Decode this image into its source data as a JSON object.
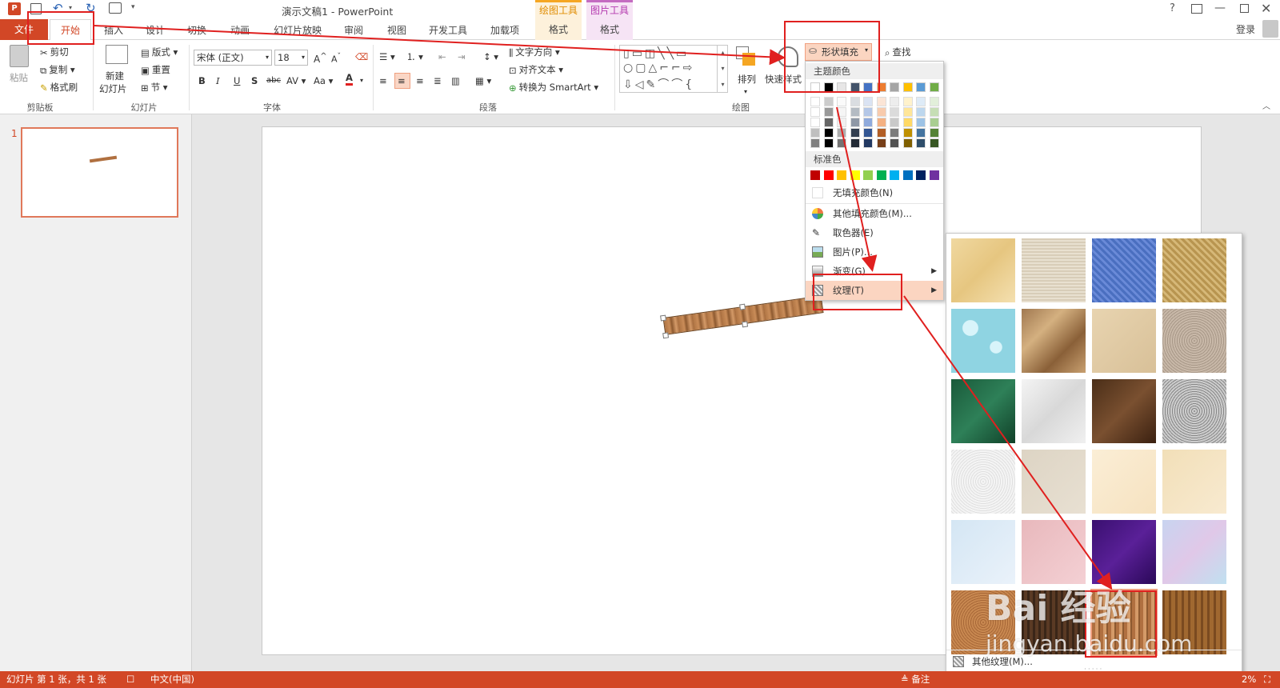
{
  "app": {
    "title": "演示文稿1 - PowerPoint",
    "context_groups": [
      {
        "label": "绘图工具",
        "color": "#f5a623",
        "tab": "格式"
      },
      {
        "label": "图片工具",
        "color": "#c46cc1",
        "tab": "格式"
      }
    ],
    "user": "登录",
    "brand_color": "#d24726"
  },
  "tabs": [
    {
      "label": "文件"
    },
    {
      "label": "开始"
    },
    {
      "label": "插入"
    },
    {
      "label": "设计"
    },
    {
      "label": "切换"
    },
    {
      "label": "动画"
    },
    {
      "label": "幻灯片放映"
    },
    {
      "label": "审阅"
    },
    {
      "label": "视图"
    },
    {
      "label": "开发工具"
    },
    {
      "label": "加载项"
    }
  ],
  "ribbon": {
    "clipboard": {
      "label": "剪贴板",
      "paste": "粘贴",
      "cut": "剪切",
      "copy": "复制",
      "painter": "格式刷"
    },
    "slides": {
      "label": "幻灯片",
      "new_slide_1": "新建",
      "new_slide_2": "幻灯片",
      "layout": "版式",
      "reset": "重置",
      "section": "节"
    },
    "font": {
      "label": "字体",
      "name": "宋体 (正文)",
      "size": "18"
    },
    "paragraph": {
      "label": "段落",
      "text_direction": "文字方向",
      "align_text": "对齐文本",
      "smartart": "转换为 SmartArt"
    },
    "drawing": {
      "label": "绘图",
      "arrange": "排列",
      "quick_styles": "快速样式",
      "shape_fill": "形状填充"
    },
    "editing": {
      "find": "查找"
    }
  },
  "dropdown": {
    "theme_colors_label": "主题颜色",
    "theme_colors": [
      "#ffffff",
      "#000000",
      "#e7e6e6",
      "#44546a",
      "#4472c4",
      "#ed7d31",
      "#a5a5a5",
      "#ffc000",
      "#5b9bd5",
      "#70ad47"
    ],
    "standard_colors_label": "标准色",
    "standard_colors": [
      "#c00000",
      "#ff0000",
      "#ffc000",
      "#ffff00",
      "#92d050",
      "#00b050",
      "#00b0f0",
      "#0070c0",
      "#002060",
      "#7030a0"
    ],
    "no_fill": "无填充颜色(N)",
    "more_colors": "其他填充颜色(M)...",
    "eyedropper": "取色器(E)",
    "picture": "图片(P)...",
    "gradient": "渐变(G)",
    "texture": "纹理(T)"
  },
  "texture_gallery": {
    "more_textures": "其他纹理(M)...",
    "textures": [
      "纸莎草纸",
      "画布",
      "斜纹布",
      "编织物",
      "水滴",
      "纸袋",
      "鱼类化石",
      "沙滩",
      "绿色大理石",
      "白色大理石",
      "褐色大理石",
      "花岗岩",
      "新闻纸",
      "再生纸",
      "羊皮纸",
      "信纸",
      "蓝色面巾纸",
      "粉色面巾纸",
      "紫色网格",
      "花束",
      "软木塞",
      "胡桃",
      "栎木",
      "中等木材"
    ],
    "selected_index": 22
  },
  "thumbnail": {
    "number": "1"
  },
  "status": {
    "slide_info": "幻灯片 第 1 张，共 1 张",
    "language": "中文(中国)",
    "notes": "备注",
    "zoom": "2%"
  },
  "watermark": {
    "text": "Bai 经验",
    "url": "jingyan.baidu.com"
  }
}
